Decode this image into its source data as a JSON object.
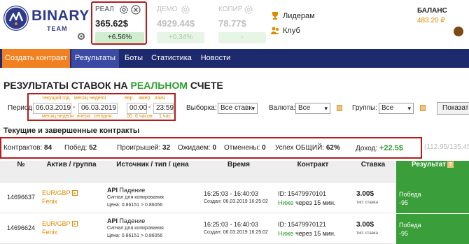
{
  "brand": {
    "word": "BINARY",
    "sub": "TEAM"
  },
  "accounts": [
    {
      "name": "РЕАЛ",
      "balance": "365.62$",
      "change": "+6.56%"
    },
    {
      "name": "ДЕМО",
      "balance": "4929.44$",
      "change": "+0.34%"
    },
    {
      "name": "КОПИР",
      "balance": "78.77$",
      "change": "-"
    }
  ],
  "header_links": {
    "leaders": "Лидерам",
    "club": "Клуб"
  },
  "balance": {
    "label": "БАЛАНС",
    "value": "483.20 ₽"
  },
  "nav": [
    "Создать контракт",
    "Результаты",
    "Боты",
    "Статистика",
    "Новости"
  ],
  "page_title": {
    "prefix": "РЕЗУЛЬТАТЫ СТАВОК НА ",
    "highlight": "РЕАЛЬНОМ",
    "suffix": " СЧЕТЕ"
  },
  "filters": {
    "period_label": "Период:",
    "date_from": "06.03.2019",
    "date_sep": "-",
    "date_to": "06.03.2019",
    "time_from": "00:00",
    "time_to": "23:59",
    "quick_top": [
      "текущий год",
      "месяц",
      "неделя",
      "евр.",
      "амер.",
      "азия"
    ],
    "quick_bottom": [
      "месяц",
      "неделя",
      "вчера",
      "сегодня",
      "00",
      "6 часов",
      "1 час"
    ],
    "sample_label": "Выборка:",
    "sample_value": "Все ставк",
    "currency_label": "Валюта:",
    "currency_value": "Все",
    "groups_label": "Группы:",
    "groups_value": "Все",
    "show_button": "Показат"
  },
  "section_title": "Текущие и завершенные контракты",
  "stats": {
    "contracts_label": "Контрактов:",
    "contracts": "84",
    "wins_label": "Побед:",
    "wins": "52",
    "losses_label": "Проигрышей:",
    "losses": "32",
    "pending_label": "Ожидаем:",
    "pending": "0",
    "cancelled_label": "Отменены:",
    "cancelled": "0",
    "success_label": "Успех ОБЩИЙ:",
    "success": "62%",
    "income_label": "Доход:",
    "income": "+22.5$",
    "tail": "(112.95/135.45)"
  },
  "table": {
    "headers": [
      "№",
      "Актив / группа",
      "Источник / тип / цена",
      "Время",
      "Контракт",
      "Ставка",
      "Результат"
    ],
    "rows": [
      {
        "num": "14696637",
        "asset": "EUR/GBP",
        "group": "Fenix",
        "src_kind": "API",
        "src_dir": "Падение",
        "src_signal": "Сигнал для копирования",
        "src_price": "Цена: 0.86151 > 0.86056",
        "time_range": "16:25:03 - 16:40:03",
        "created": "Создан: 06.03.2019 16:25:02",
        "contract_id": "ID: 15479970101",
        "contract_dir": "Ниже",
        "contract_term": "через 15 мин.",
        "stake": "3.00$",
        "stake_type": "тип: ставка",
        "result": "Победа",
        "result_value": "-95"
      },
      {
        "num": "14696624",
        "asset": "EUR/GBP",
        "group": "Fenix",
        "src_kind": "API",
        "src_dir": "Падение",
        "src_signal": "Сигнал для копирования",
        "src_price": "Цена: 0.86151 > 0.86056",
        "time_range": "16:25:03 - 16:40:03",
        "created": "Создан: 06.03.2019 16:25:02",
        "contract_id": "ID: 15479970121",
        "contract_dir": "Ниже",
        "contract_term": "через 15 мин.",
        "stake": "3.00$",
        "stake_type": "тип: ставка",
        "result": "Победа",
        "result_value": "-95"
      }
    ]
  },
  "colors": {
    "nav_bg": "#1e2a6e",
    "accent_orange": "#f08020",
    "win_green": "#3a9e3a",
    "highlight_red": "#b71c1c"
  },
  "icons": [
    "binary-team-logo-icon",
    "gear-icon",
    "close-circle-icon",
    "trophy-icon",
    "club-icon",
    "calendar-icon",
    "avatar-icon"
  ]
}
